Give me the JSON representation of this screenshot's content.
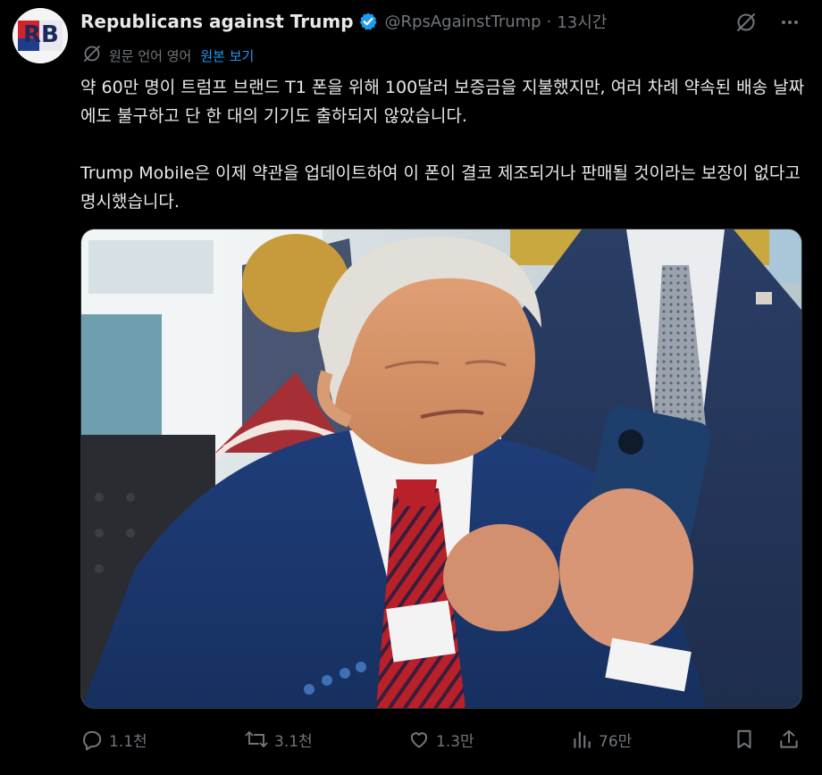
{
  "post": {
    "author_name": "Republicans against Trump",
    "handle": "@RpsAgainstTrump",
    "separator": "·",
    "time": "13시간",
    "avatar_text": "RB",
    "translation": {
      "label": "원문 언어 영어",
      "show_original": "원본 보기"
    },
    "text": [
      "약 60만 명이 트럼프 브랜드 T1 폰을 위해 100달러 보증금을 지불했지만, 여러 차례 약속된 배송 날짜에도 불구하고 단 한 대의 기기도 출하되지 않았습니다.",
      "Trump Mobile은 이제 약관을 업데이트하여 이 폰이 결코 제조되거나 판매될 것이라는 보장이 없다고 명시했습니다."
    ]
  },
  "actions": {
    "replies": "1.1천",
    "reposts": "3.1천",
    "likes": "1.3만",
    "views": "76만"
  },
  "icons": [
    "verified-badge-icon",
    "grok-icon",
    "more-icon",
    "translate-icon",
    "reply-icon",
    "repost-icon",
    "like-icon",
    "views-icon",
    "bookmark-icon",
    "share-icon"
  ],
  "colors": {
    "accent": "#1d9bf0",
    "muted": "#71767b",
    "text": "#e7e9ea",
    "background": "#000000"
  }
}
